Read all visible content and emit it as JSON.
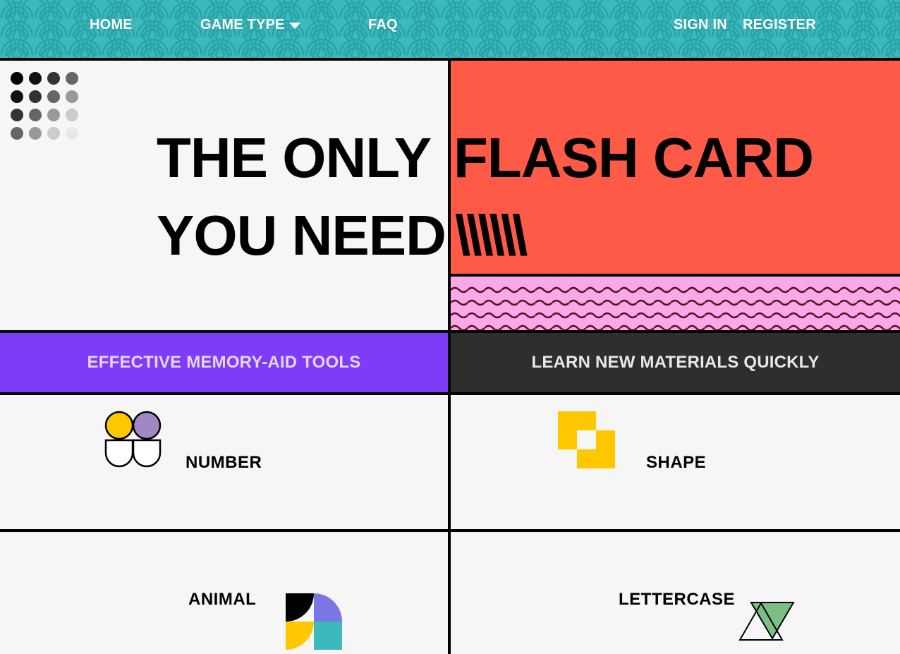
{
  "nav": {
    "home": "HOME",
    "game_type": "GAME TYPE",
    "faq": "FAQ",
    "sign_in": "SIGN IN",
    "register": "REGISTER"
  },
  "hero": {
    "line1_left": "THE ONLY",
    "line1_right": "FLASH CARD",
    "line2_left": "YOU NEED",
    "line2_right": "\\\\\\\\\\\\"
  },
  "bands": {
    "left": "EFFECTIVE MEMORY-AID TOOLS",
    "right": "LEARN NEW MATERIALS QUICKLY"
  },
  "categories": {
    "number": "NUMBER",
    "shape": "SHAPE",
    "animal": "ANIMAL",
    "lettercase": "LETTERCASE"
  },
  "colors": {
    "nav_teal": "#3bb9bd",
    "coral": "#ff5a48",
    "pink": "#f9a8e8",
    "purple": "#7e3bf8",
    "dark": "#2e2e2e",
    "yellow": "#ffc700",
    "lavender": "#a286c6",
    "periwinkle": "#7b75e6",
    "green": "#7bbf85"
  }
}
